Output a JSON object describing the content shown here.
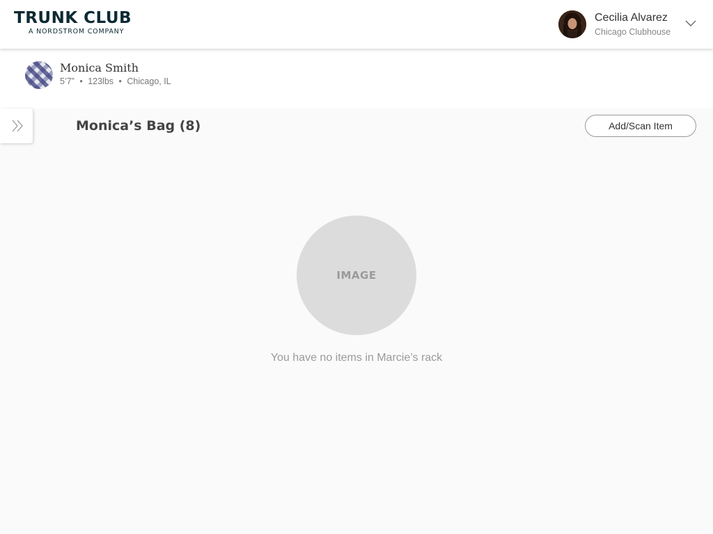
{
  "header": {
    "logo_main": "TRUNK CLUB",
    "logo_sub": "A NORDSTROM COMPANY",
    "user": {
      "name": "Cecilia Alvarez",
      "location": "Chicago Clubhouse",
      "avatar_icon": "user-photo",
      "menu_icon": "chevron-down-icon"
    }
  },
  "client": {
    "name": "Monica Smith",
    "height": "5’7”",
    "weight": "123lbs",
    "location": "Chicago, IL",
    "avatar_icon": "plaid-pattern-avatar"
  },
  "drawer": {
    "toggle_icon": "double-chevron-right-icon"
  },
  "bag": {
    "title": "Monica’s Bag (8)",
    "add_scan_label": "Add/Scan Item"
  },
  "empty_state": {
    "image_label": "IMAGE",
    "message": "You have no items in Marcie’s rack"
  },
  "colors": {
    "brand": "#0d2a33",
    "background": "#fafafa",
    "placeholder": "#dcdcdc"
  }
}
